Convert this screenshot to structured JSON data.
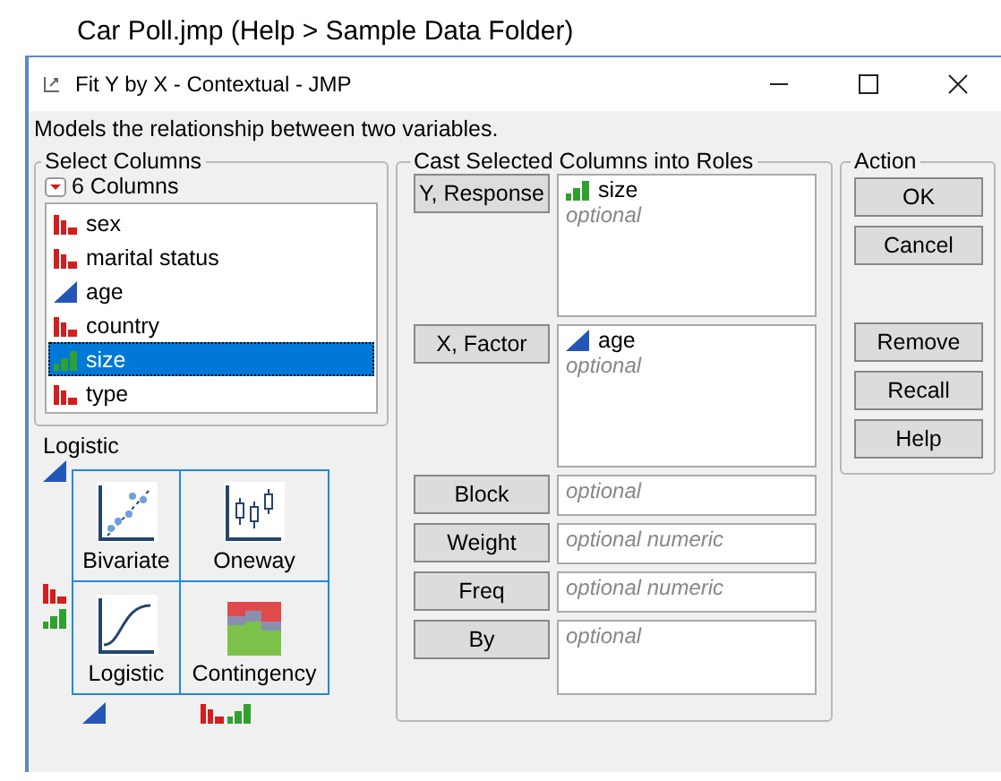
{
  "caption": "Car Poll.jmp (Help > Sample Data Folder)",
  "window": {
    "title": "Fit Y by X - Contextual - JMP"
  },
  "description": "Models the relationship between two variables.",
  "select_columns": {
    "title": "Select Columns",
    "count": "6 Columns",
    "columns": [
      {
        "name": "sex",
        "kind": "nominal",
        "selected": false
      },
      {
        "name": "marital status",
        "kind": "nominal",
        "selected": false
      },
      {
        "name": "age",
        "kind": "continuous",
        "selected": false
      },
      {
        "name": "country",
        "kind": "nominal",
        "selected": false
      },
      {
        "name": "size",
        "kind": "ordinal",
        "selected": true
      },
      {
        "name": "type",
        "kind": "nominal",
        "selected": false
      }
    ]
  },
  "platforms": {
    "label": "Logistic",
    "cells": [
      {
        "name": "Bivariate",
        "kind": "bivariate"
      },
      {
        "name": "Oneway",
        "kind": "oneway"
      },
      {
        "name": "Logistic",
        "kind": "logistic"
      },
      {
        "name": "Contingency",
        "kind": "contingency"
      }
    ]
  },
  "roles": {
    "title": "Cast Selected Columns into Roles",
    "items": [
      {
        "label": "Y, Response",
        "kind": "list",
        "columns": [
          {
            "name": "size",
            "kind": "ordinal"
          }
        ],
        "placeholder": "optional"
      },
      {
        "label": "X, Factor",
        "kind": "list",
        "columns": [
          {
            "name": "age",
            "kind": "continuous"
          }
        ],
        "placeholder": "optional"
      },
      {
        "label": "Block",
        "kind": "field",
        "placeholder": "optional"
      },
      {
        "label": "Weight",
        "kind": "field",
        "placeholder": "optional numeric"
      },
      {
        "label": "Freq",
        "kind": "field",
        "placeholder": "optional numeric"
      },
      {
        "label": "By",
        "kind": "box",
        "placeholder": "optional"
      }
    ]
  },
  "action": {
    "title": "Action",
    "buttons": [
      "OK",
      "Cancel"
    ],
    "column_buttons": [
      "Remove",
      "Recall",
      "Help"
    ]
  }
}
